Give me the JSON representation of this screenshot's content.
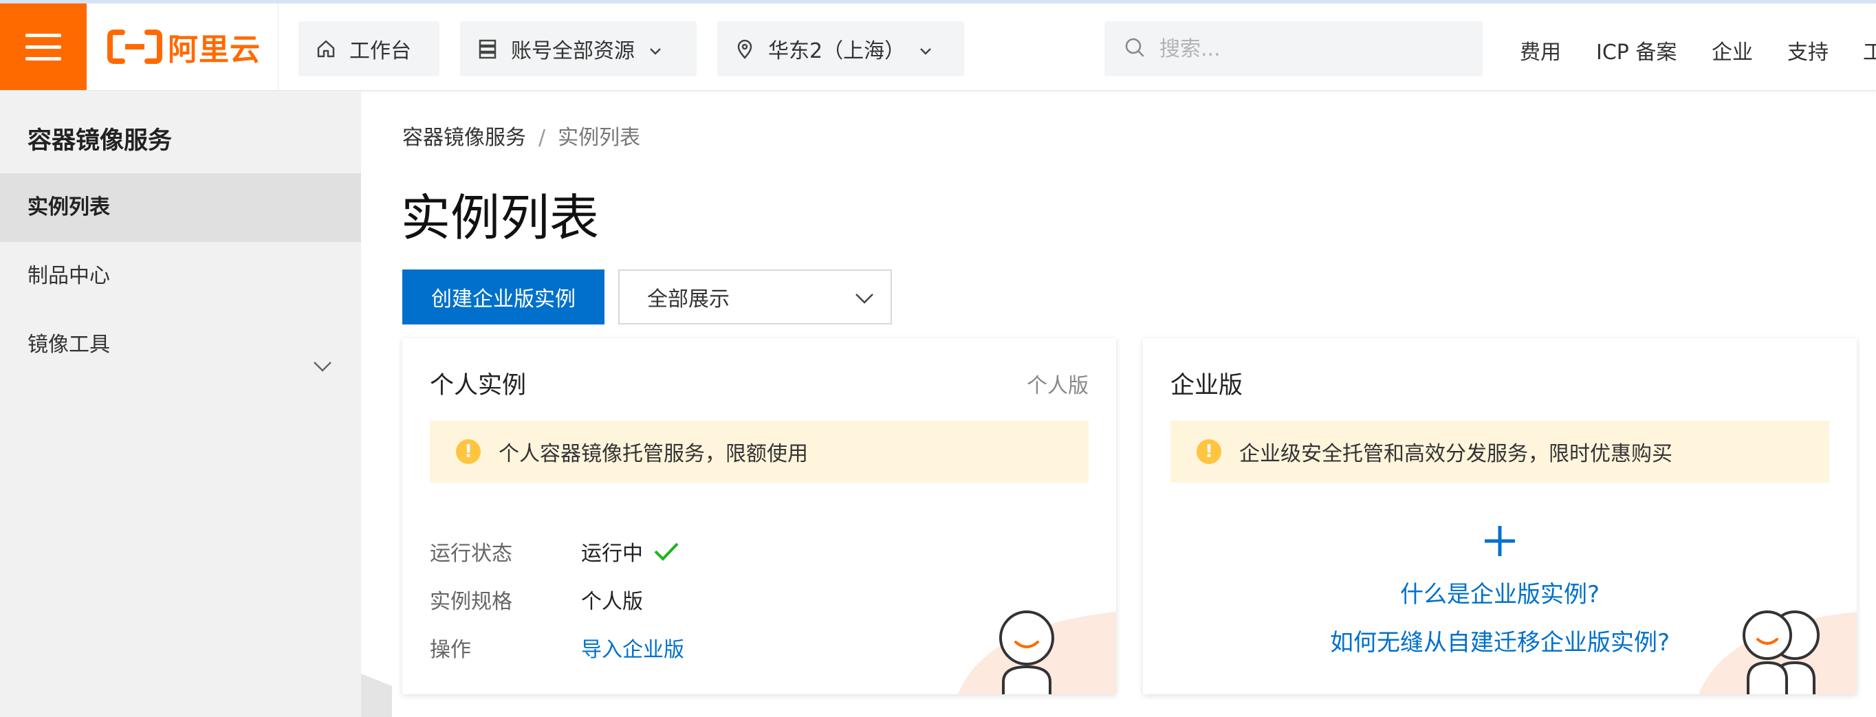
{
  "header": {
    "logo_text": "阿里云",
    "workbench_label": "工作台",
    "resources_label": "账号全部资源",
    "region_label": "华东2（上海）",
    "search_placeholder": "搜索...",
    "links": [
      "费用",
      "ICP 备案",
      "企业",
      "支持",
      "工"
    ],
    "brand_color": "#ff6a00"
  },
  "sidebar": {
    "title": "容器镜像服务",
    "items": [
      {
        "label": "实例列表",
        "active": true
      },
      {
        "label": "制品中心",
        "active": false
      },
      {
        "label": "镜像工具",
        "active": false,
        "expandable": true
      }
    ]
  },
  "breadcrumb": {
    "root": "容器镜像服务",
    "separator": "/",
    "current": "实例列表"
  },
  "page": {
    "title": "实例列表",
    "create_button": "创建企业版实例",
    "filter_select": "全部展示"
  },
  "personal_card": {
    "title": "个人实例",
    "tag": "个人版",
    "notice": "个人容器镜像托管服务，限额使用",
    "status_label": "运行状态",
    "status_value": "运行中",
    "spec_label": "实例规格",
    "spec_value": "个人版",
    "action_label": "操作",
    "action_link": "导入企业版"
  },
  "enterprise_card": {
    "title": "企业版",
    "notice": "企业级安全托管和高效分发服务，限时优惠购买",
    "link_what": "什么是企业版实例?",
    "link_migrate": "如何无缝从自建迁移企业版实例?"
  },
  "colors": {
    "primary": "#0070cc",
    "success": "#1eb41e",
    "warning": "#ffc440",
    "notice_bg": "#fff5dc"
  }
}
